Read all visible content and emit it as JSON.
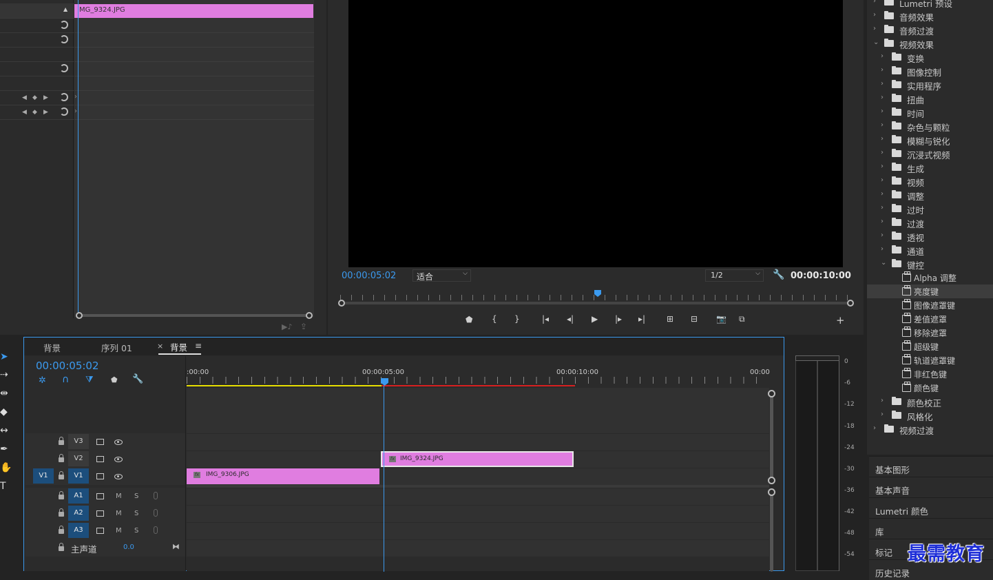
{
  "effect_controls": {
    "clip_name": "IMG_9324.JPG"
  },
  "program_monitor": {
    "current_time": "00:00:05:02",
    "fit_option": "适合",
    "resolution": "1/2",
    "duration": "00:00:10:00"
  },
  "timeline": {
    "tabs": [
      {
        "label": "背景"
      },
      {
        "label": "序列 01"
      },
      {
        "label": "背景",
        "active": true
      }
    ],
    "close_glyph": "×",
    "menu_glyph": "≡",
    "current_time": "00:00:05:02",
    "ruler_labels": [
      ":00:00",
      "00:00:05:00",
      "00:00:10:00",
      "00:00"
    ],
    "video_tracks": [
      {
        "name": "V3",
        "target": ""
      },
      {
        "name": "V2",
        "target": ""
      },
      {
        "name": "V1",
        "target": "V1"
      }
    ],
    "audio_tracks": [
      {
        "name": "A1",
        "m": "M",
        "s": "S"
      },
      {
        "name": "A2",
        "m": "M",
        "s": "S"
      },
      {
        "name": "A3",
        "m": "M",
        "s": "S"
      }
    ],
    "master": {
      "label": "主声道",
      "value": "0.0"
    },
    "clips": [
      {
        "name": "IMG_9324.JPG",
        "track": "V2"
      },
      {
        "name": "IMG_9306.JPG",
        "track": "V1"
      }
    ]
  },
  "audio_meter": {
    "labels": [
      "0",
      "-6",
      "-12",
      "-18",
      "-24",
      "-30",
      "-36",
      "-42",
      "-48",
      "-54"
    ]
  },
  "effects_panel": {
    "tree": [
      {
        "label": "Lumetri 预设",
        "level": 0,
        "kind": "folder",
        "open": false
      },
      {
        "label": "音频效果",
        "level": 0,
        "kind": "folder",
        "open": false
      },
      {
        "label": "音频过渡",
        "level": 0,
        "kind": "folder",
        "open": false
      },
      {
        "label": "视频效果",
        "level": 0,
        "kind": "folder",
        "open": true
      },
      {
        "label": "变换",
        "level": 1,
        "kind": "folder",
        "open": false
      },
      {
        "label": "图像控制",
        "level": 1,
        "kind": "folder",
        "open": false
      },
      {
        "label": "实用程序",
        "level": 1,
        "kind": "folder",
        "open": false
      },
      {
        "label": "扭曲",
        "level": 1,
        "kind": "folder",
        "open": false
      },
      {
        "label": "时间",
        "level": 1,
        "kind": "folder",
        "open": false
      },
      {
        "label": "杂色与颗粒",
        "level": 1,
        "kind": "folder",
        "open": false
      },
      {
        "label": "模糊与锐化",
        "level": 1,
        "kind": "folder",
        "open": false
      },
      {
        "label": "沉浸式视频",
        "level": 1,
        "kind": "folder",
        "open": false
      },
      {
        "label": "生成",
        "level": 1,
        "kind": "folder",
        "open": false
      },
      {
        "label": "视频",
        "level": 1,
        "kind": "folder",
        "open": false
      },
      {
        "label": "调整",
        "level": 1,
        "kind": "folder",
        "open": false
      },
      {
        "label": "过时",
        "level": 1,
        "kind": "folder",
        "open": false
      },
      {
        "label": "过渡",
        "level": 1,
        "kind": "folder",
        "open": false
      },
      {
        "label": "透视",
        "level": 1,
        "kind": "folder",
        "open": false
      },
      {
        "label": "通道",
        "level": 1,
        "kind": "folder",
        "open": false
      },
      {
        "label": "键控",
        "level": 1,
        "kind": "folder",
        "open": true
      },
      {
        "label": "Alpha 调整",
        "level": 2,
        "kind": "effect"
      },
      {
        "label": "亮度键",
        "level": 2,
        "kind": "effect",
        "selected": true
      },
      {
        "label": "图像遮罩键",
        "level": 2,
        "kind": "effect"
      },
      {
        "label": "差值遮罩",
        "level": 2,
        "kind": "effect"
      },
      {
        "label": "移除遮罩",
        "level": 2,
        "kind": "effect"
      },
      {
        "label": "超级键",
        "level": 2,
        "kind": "effect"
      },
      {
        "label": "轨道遮罩键",
        "level": 2,
        "kind": "effect"
      },
      {
        "label": "非红色键",
        "level": 2,
        "kind": "effect"
      },
      {
        "label": "颜色键",
        "level": 2,
        "kind": "effect"
      },
      {
        "label": "颜色校正",
        "level": 1,
        "kind": "folder",
        "open": false
      },
      {
        "label": "风格化",
        "level": 1,
        "kind": "folder",
        "open": false
      },
      {
        "label": "视频过渡",
        "level": 0,
        "kind": "folder",
        "open": false
      }
    ],
    "sections": [
      "基本图形",
      "基本声音",
      "Lumetri 颜色",
      "库",
      "标记",
      "历史记录"
    ]
  },
  "watermark": "最需教育",
  "colors": {
    "accent_blue": "#3b9aef",
    "clip_pink": "#e07de0",
    "work_area_yellow": "#e8e000",
    "render_red": "#d82020"
  }
}
